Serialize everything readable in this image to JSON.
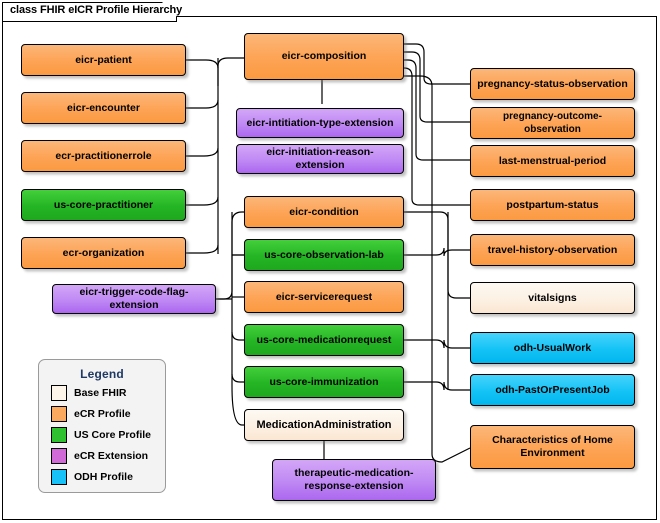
{
  "diagram": {
    "title": "class FHIR eICR Profile Hierarchy",
    "kind": "uml-class-hierarchy"
  },
  "colors": {
    "base_fhir": "#fdf4ea",
    "ecr_profile": "#fba95f",
    "us_core_profile": "#2fc12f",
    "ecr_extension": "#d06ad6",
    "odh_profile": "#18c2f8",
    "border": "#000000",
    "canvas": "#ffffff",
    "legend_title": "#1f3864",
    "legend_background": "#f3f3f3"
  },
  "nodes": {
    "left": [
      {
        "id": "eicr-patient",
        "label": "eicr-patient",
        "type": "ecr"
      },
      {
        "id": "eicr-encounter",
        "label": "eicr-encounter",
        "type": "ecr"
      },
      {
        "id": "ecr-practitionerrole",
        "label": "ecr-practitionerrole",
        "type": "ecr"
      },
      {
        "id": "us-core-practitioner",
        "label": "us-core-practitioner",
        "type": "us-core"
      },
      {
        "id": "ecr-organization",
        "label": "ecr-organization",
        "type": "ecr"
      },
      {
        "id": "eicr-trigger-code-flag-extension",
        "label": "eicr-trigger-code-flag-extension",
        "type": "ecr-extension"
      }
    ],
    "center": [
      {
        "id": "eicr-composition",
        "label": "eicr-composition",
        "type": "ecr"
      },
      {
        "id": "eicr-intitiation-type-extension",
        "label": "eicr-intitiation-type-extension",
        "type": "ecr-extension"
      },
      {
        "id": "eicr-initiation-reason-extension",
        "label": "eicr-initiation-reason-extension",
        "type": "ecr-extension"
      },
      {
        "id": "eicr-condition",
        "label": "eicr-condition",
        "type": "ecr"
      },
      {
        "id": "us-core-observation-lab",
        "label": "us-core-observation-lab",
        "type": "us-core"
      },
      {
        "id": "eicr-servicerequest",
        "label": "eicr-servicerequest",
        "type": "ecr"
      },
      {
        "id": "us-core-medicationrequest",
        "label": "us-core-medicationrequest",
        "type": "us-core"
      },
      {
        "id": "us-core-immunization",
        "label": "us-core-immunization",
        "type": "us-core"
      },
      {
        "id": "MedicationAdministration",
        "label": "MedicationAdministration",
        "type": "base-fhir"
      },
      {
        "id": "therapeutic-medication-response-extension",
        "label": "therapeutic-medication-response-extension",
        "type": "ecr-extension"
      }
    ],
    "right": [
      {
        "id": "pregnancy-status-observation",
        "label": "pregnancy-status-observation",
        "type": "ecr"
      },
      {
        "id": "pregnancy-outcome-observation",
        "label": "pregnancy-outcome-observation",
        "type": "ecr"
      },
      {
        "id": "last-menstrual-period",
        "label": "last-menstrual-period",
        "type": "ecr"
      },
      {
        "id": "postpartum-status",
        "label": "postpartum-status",
        "type": "ecr"
      },
      {
        "id": "travel-history-observation",
        "label": "travel-history-observation",
        "type": "ecr"
      },
      {
        "id": "vitalsigns",
        "label": "vitalsigns",
        "type": "base-fhir"
      },
      {
        "id": "odh-UsualWork",
        "label": "odh-UsualWork",
        "type": "odh"
      },
      {
        "id": "odh-PastOrPresentJob",
        "label": "odh-PastOrPresentJob",
        "type": "odh"
      },
      {
        "id": "characteristics-of-home-environment",
        "label": "Characteristics of Home Environment",
        "type": "ecr"
      }
    ]
  },
  "legend": {
    "title": "Legend",
    "items": [
      {
        "label": "Base FHIR",
        "color": "#fdf4ea"
      },
      {
        "label": "eCR Profile",
        "color": "#fba95f"
      },
      {
        "label": "US Core Profile",
        "color": "#2fc12f"
      },
      {
        "label": "eCR Extension",
        "color": "#d06ad6"
      },
      {
        "label": "ODH Profile",
        "color": "#18c2f8"
      }
    ]
  }
}
